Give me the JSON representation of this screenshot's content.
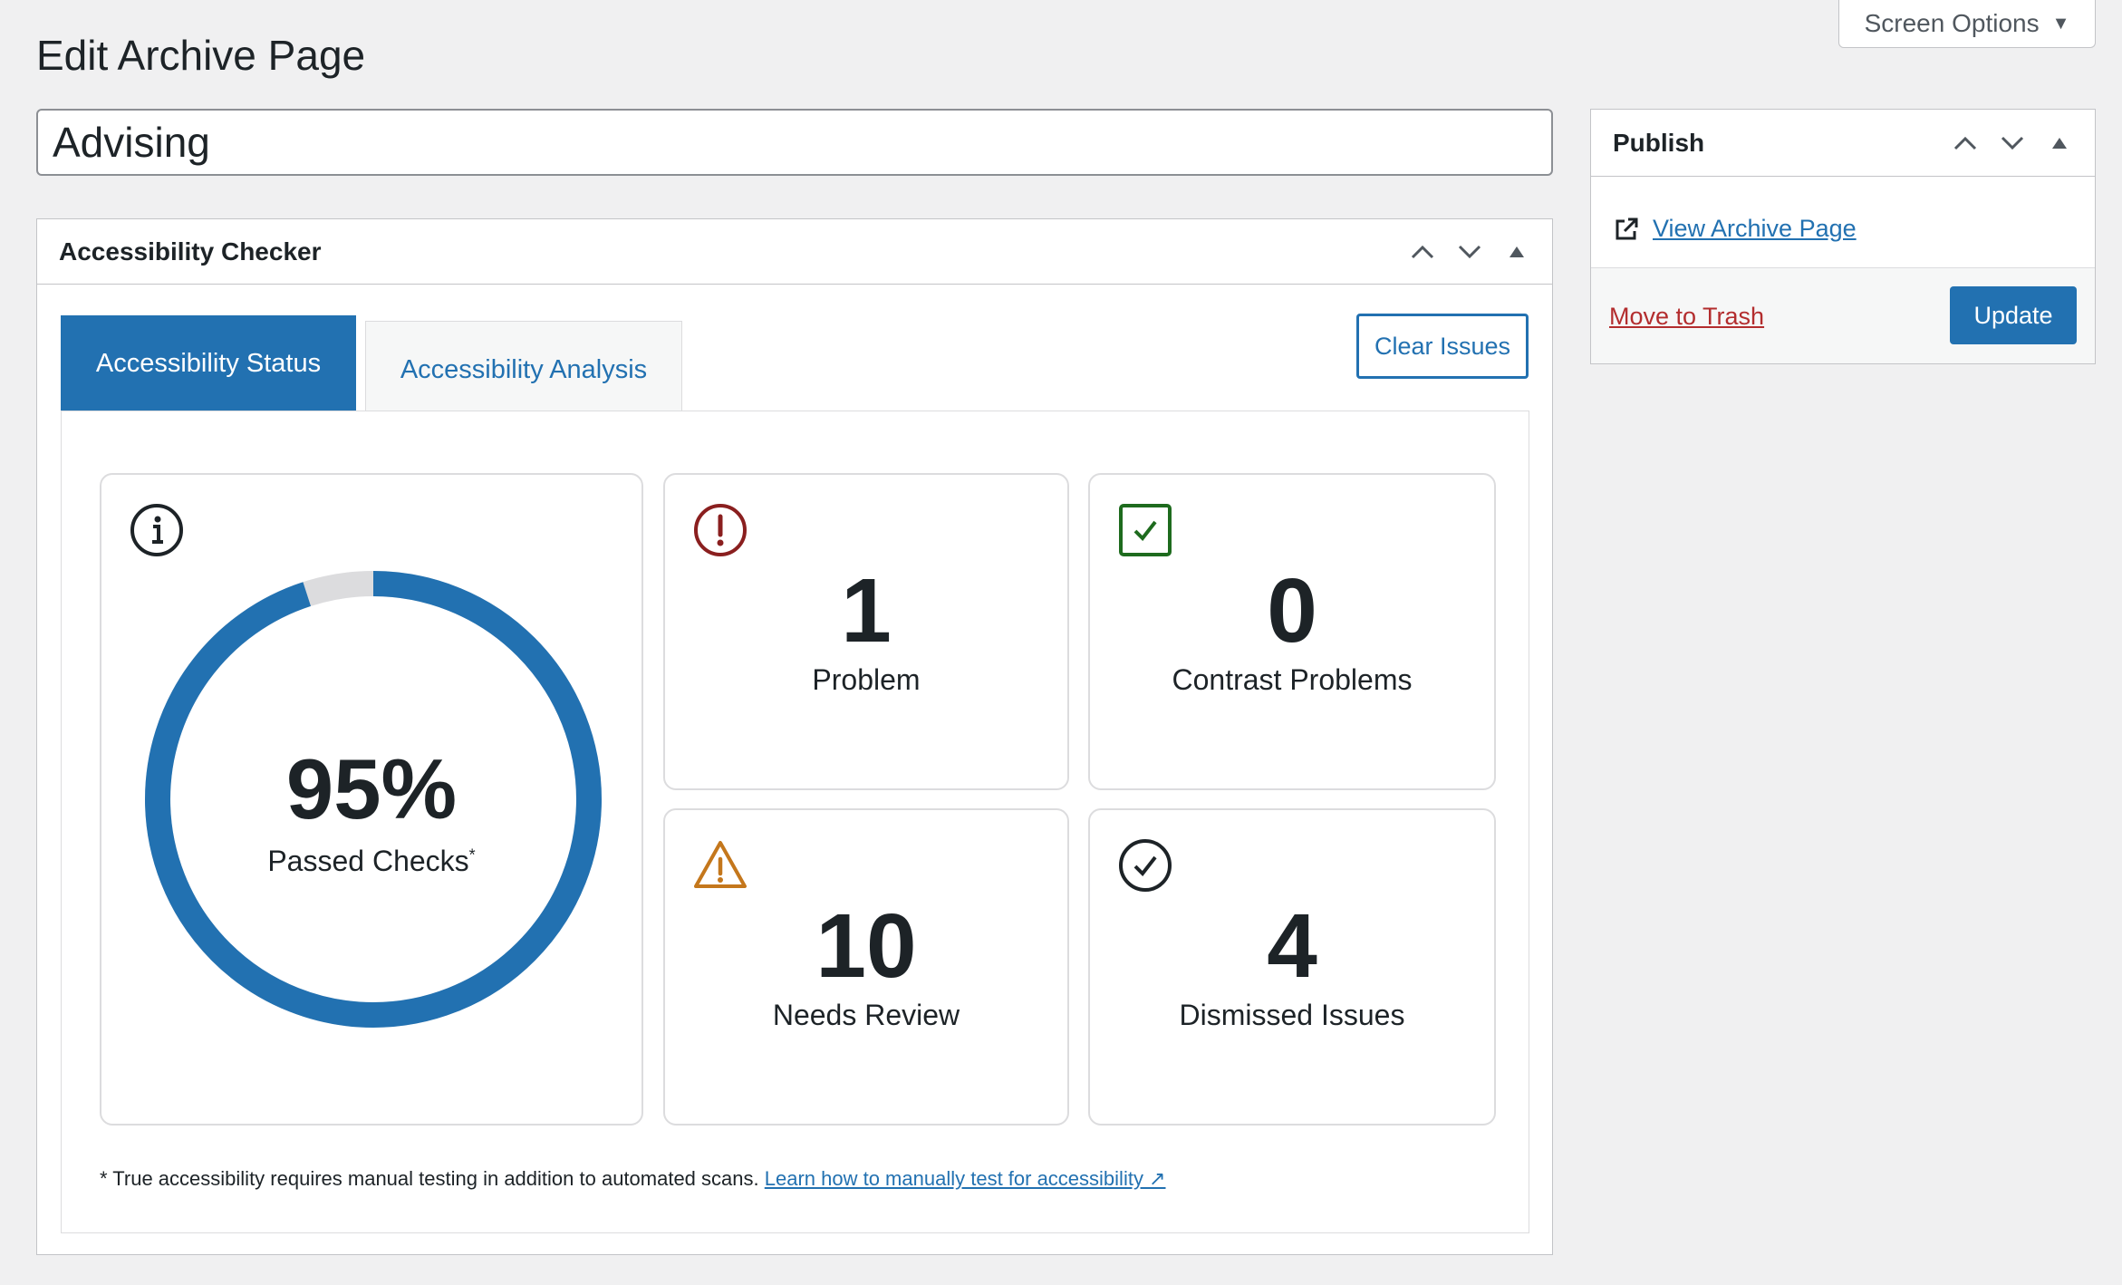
{
  "header": {
    "screen_options_label": "Screen Options",
    "page_title": "Edit Archive Page"
  },
  "post": {
    "title_value": "Advising"
  },
  "checker": {
    "title": "Accessibility Checker",
    "tabs": [
      {
        "label": "Accessibility Status",
        "active": true
      },
      {
        "label": "Accessibility Analysis",
        "active": false
      }
    ],
    "clear_issues_label": "Clear Issues",
    "passed": {
      "percent_label": "95%",
      "percent_value": 95,
      "label": "Passed Checks",
      "footnote_mark": "*"
    },
    "stats": {
      "problem": {
        "value": "1",
        "label": "Problem"
      },
      "contrast": {
        "value": "0",
        "label": "Contrast Problems"
      },
      "review": {
        "value": "10",
        "label": "Needs Review"
      },
      "dismissed": {
        "value": "4",
        "label": "Dismissed Issues"
      }
    },
    "footnote_text": "* True accessibility requires manual testing in addition to automated scans.",
    "footnote_link": "Learn how to manually test for accessibility ↗"
  },
  "publish": {
    "title": "Publish",
    "view_link": "View Archive Page",
    "trash_link": "Move to Trash",
    "update_label": "Update"
  },
  "colors": {
    "accent": "#2271b1",
    "problem": "#8a1f1f",
    "success": "#1e6b1e",
    "warning": "#c4771c",
    "gauge_track": "#dcdcde"
  }
}
